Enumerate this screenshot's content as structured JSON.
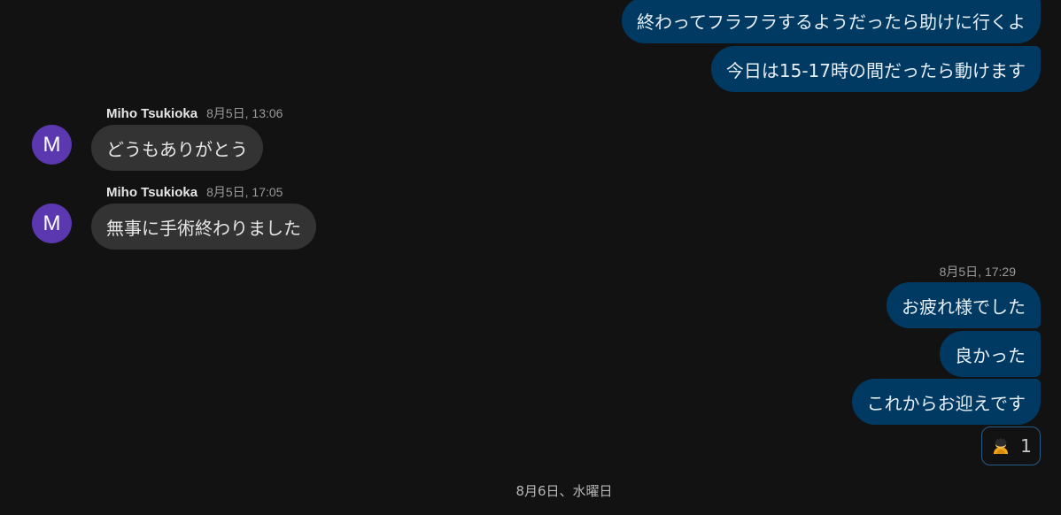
{
  "outgoing_top": [
    {
      "text": "終わってフラフラするようだったら助けに行くよ"
    },
    {
      "text": "今日は15-17時の間だったら動けます"
    }
  ],
  "incoming": [
    {
      "avatar": "M",
      "sender": "Miho Tsukioka",
      "time": "8月5日, 13:06",
      "text": "どうもありがとう"
    },
    {
      "avatar": "M",
      "sender": "Miho Tsukioka",
      "time": "8月5日, 17:05",
      "text": "無事に手術終わりました"
    }
  ],
  "outgoing_group": {
    "time": "8月5日, 17:29",
    "messages": [
      {
        "text": "お疲れ様でした"
      },
      {
        "text": "良かった"
      },
      {
        "text": "これからお迎えです"
      }
    ]
  },
  "reaction": {
    "icon": "bowing-person-emoji",
    "count": "1"
  },
  "date_divider": "8月6日、水曜日",
  "colors": {
    "background": "#121212",
    "outgoing_bubble": "#003a63",
    "incoming_bubble": "#333333",
    "avatar": "#5b38b0",
    "reaction_border": "#2a5a8a"
  }
}
